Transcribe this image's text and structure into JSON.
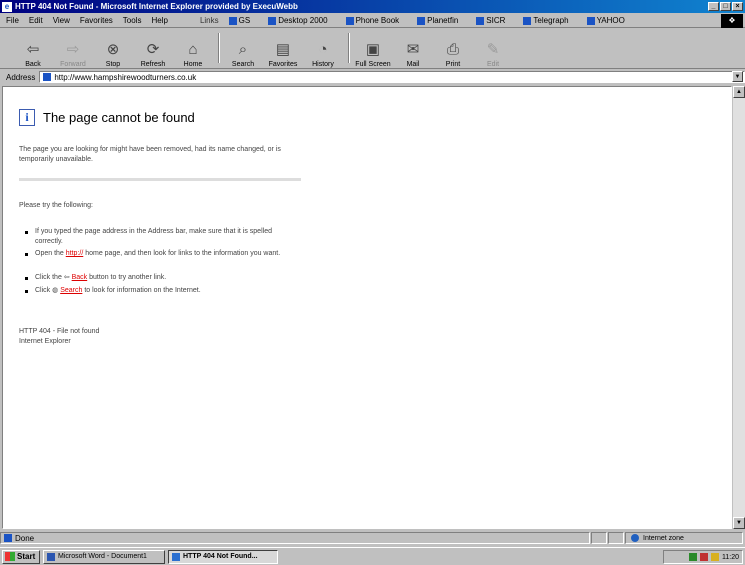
{
  "window": {
    "title": "HTTP 404 Not Found - Microsoft Internet Explorer provided by ExecuWebb",
    "controls": [
      "_",
      "□",
      "×"
    ]
  },
  "menu": [
    "File",
    "Edit",
    "View",
    "Favorites",
    "Tools",
    "Help"
  ],
  "links": {
    "label": "Links",
    "items": [
      "GS",
      "Desktop 2000",
      "Phone Book",
      "Planetfin",
      "SICR",
      "Telegraph",
      "YAHOO"
    ]
  },
  "toolbar": {
    "back": "Back",
    "forward": "Forward",
    "stop": "Stop",
    "refresh": "Refresh",
    "home": "Home",
    "search": "Search",
    "favorites": "Favorites",
    "history": "History",
    "fullscreen": "Full Screen",
    "mail": "Mail",
    "print": "Print",
    "edit": "Edit"
  },
  "address": {
    "label": "Address",
    "url": "http://www.hampshirewoodturners.co.uk"
  },
  "page": {
    "title": "The page cannot be found",
    "intro": "The page you are looking for might have been removed, had its name changed, or is temporarily unavailable.",
    "please": "Please try the following:",
    "b1": "If you typed the page address in the Address bar, make sure that it is spelled correctly.",
    "b2_pre": "Open the ",
    "b2_link": "http://",
    "b2_post": " home page, and then look for links to the information you want.",
    "b3_pre": "Click the ",
    "b3_link": "Back",
    "b3_post": " button to try another link.",
    "b4_pre": "Click ",
    "b4_link": "Search",
    "b4_post": " to look for information on the Internet.",
    "code": "HTTP 404 - File not found",
    "browser": "Internet Explorer"
  },
  "status": {
    "text": "Done",
    "zone": "Internet zone"
  },
  "taskbar": {
    "start": "Start",
    "tasks": [
      "Microsoft Word - Document1",
      "HTTP 404 Not Found..."
    ],
    "clock": "11:20"
  }
}
